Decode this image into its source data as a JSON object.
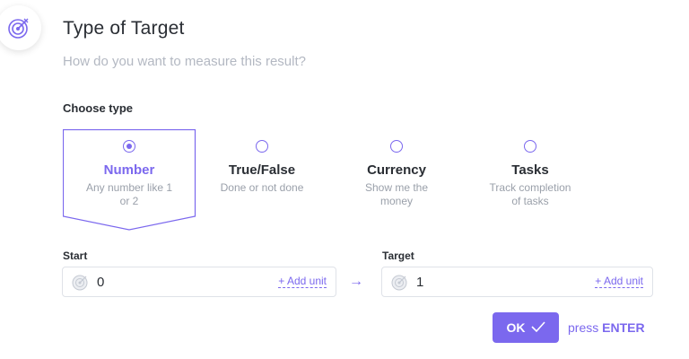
{
  "header": {
    "icon": "target-icon",
    "title": "Type of Target",
    "subtitle": "How do you want to measure this result?"
  },
  "choose_type": {
    "label": "Choose type",
    "selected": "Number",
    "options": [
      {
        "name": "Number",
        "desc": "Any number like 1 or 2",
        "selected": true
      },
      {
        "name": "True/False",
        "desc": "Done or not done",
        "selected": false
      },
      {
        "name": "Currency",
        "desc": "Show me the money",
        "selected": false
      },
      {
        "name": "Tasks",
        "desc": "Track completion of tasks",
        "selected": false
      }
    ]
  },
  "start": {
    "label": "Start",
    "value": "0",
    "add_unit": "+ Add unit",
    "icon": "target-icon"
  },
  "arrow": "→",
  "target": {
    "label": "Target",
    "value": "1",
    "add_unit": "+ Add unit",
    "icon": "target-icon"
  },
  "actions": {
    "ok_label": "OK",
    "ok_icon": "checkmark-icon",
    "hint_prefix": "press",
    "hint_key": "ENTER"
  },
  "colors": {
    "accent": "#7b68ee",
    "muted_text": "#9aa0aa",
    "border": "#dfe2e8"
  }
}
